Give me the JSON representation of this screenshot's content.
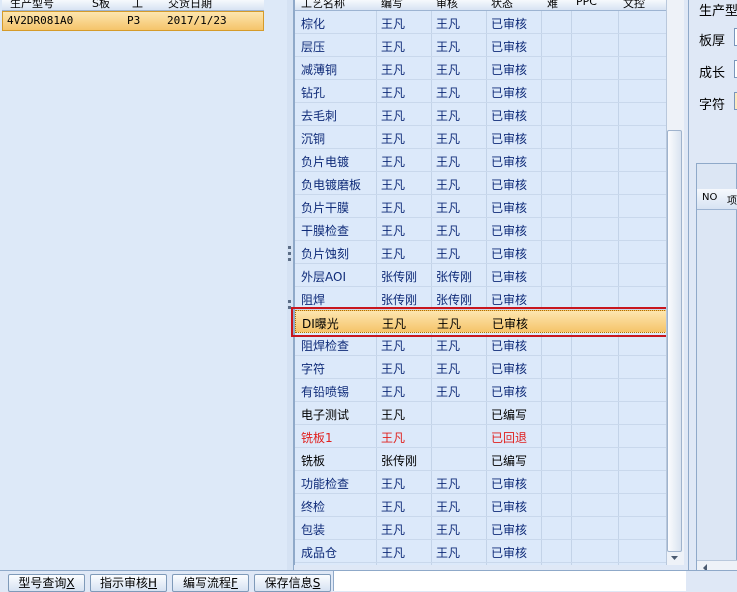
{
  "left_table": {
    "columns": [
      "生产型号",
      "S板",
      "工",
      "交货日期"
    ],
    "rows": [
      {
        "model": "4V2DR081A0",
        "board": "",
        "process": "P3",
        "date": "2017/1/23"
      }
    ]
  },
  "grid": {
    "columns": [
      "工艺名称",
      "编写",
      "审核",
      "状态",
      "难",
      "PPC",
      "文控"
    ],
    "rows": [
      {
        "process": "棕化",
        "writer": "王凡",
        "reviewer": "王凡",
        "status": "已审核",
        "kind": "normal"
      },
      {
        "process": "层压",
        "writer": "王凡",
        "reviewer": "王凡",
        "status": "已审核",
        "kind": "normal"
      },
      {
        "process": "减薄铜",
        "writer": "王凡",
        "reviewer": "王凡",
        "status": "已审核",
        "kind": "normal"
      },
      {
        "process": "钻孔",
        "writer": "王凡",
        "reviewer": "王凡",
        "status": "已审核",
        "kind": "normal"
      },
      {
        "process": "去毛刺",
        "writer": "王凡",
        "reviewer": "王凡",
        "status": "已审核",
        "kind": "normal"
      },
      {
        "process": "沉铜",
        "writer": "王凡",
        "reviewer": "王凡",
        "status": "已审核",
        "kind": "normal"
      },
      {
        "process": "负片电镀",
        "writer": "王凡",
        "reviewer": "王凡",
        "status": "已审核",
        "kind": "normal"
      },
      {
        "process": "负电镀磨板",
        "writer": "王凡",
        "reviewer": "王凡",
        "status": "已审核",
        "kind": "normal"
      },
      {
        "process": "负片干膜",
        "writer": "王凡",
        "reviewer": "王凡",
        "status": "已审核",
        "kind": "normal"
      },
      {
        "process": "干膜检查",
        "writer": "王凡",
        "reviewer": "王凡",
        "status": "已审核",
        "kind": "normal"
      },
      {
        "process": "负片蚀刻",
        "writer": "王凡",
        "reviewer": "王凡",
        "status": "已审核",
        "kind": "normal"
      },
      {
        "process": "外层AOI",
        "writer": "张传刚",
        "reviewer": "张传刚",
        "status": "已审核",
        "kind": "normal"
      },
      {
        "process": "阻焊",
        "writer": "张传刚",
        "reviewer": "张传刚",
        "status": "已审核",
        "kind": "normal"
      },
      {
        "process": "DI曝光",
        "writer": "王凡",
        "reviewer": "王凡",
        "status": "已审核",
        "kind": "selected"
      },
      {
        "process": "阻焊检查",
        "writer": "王凡",
        "reviewer": "王凡",
        "status": "已审核",
        "kind": "normal"
      },
      {
        "process": "字符",
        "writer": "王凡",
        "reviewer": "王凡",
        "status": "已审核",
        "kind": "normal"
      },
      {
        "process": "有铅喷锡",
        "writer": "王凡",
        "reviewer": "王凡",
        "status": "已审核",
        "kind": "normal"
      },
      {
        "process": "电子测试",
        "writer": "王凡",
        "reviewer": "",
        "status": "已编写",
        "kind": "plain"
      },
      {
        "process": "铣板1",
        "writer": "王凡",
        "reviewer": "",
        "status": "已回退",
        "kind": "returned"
      },
      {
        "process": "铣板",
        "writer": "张传刚",
        "reviewer": "",
        "status": "已编写",
        "kind": "plain"
      },
      {
        "process": "功能检查",
        "writer": "王凡",
        "reviewer": "王凡",
        "status": "已审核",
        "kind": "normal"
      },
      {
        "process": "终检",
        "writer": "王凡",
        "reviewer": "王凡",
        "status": "已审核",
        "kind": "normal"
      },
      {
        "process": "包装",
        "writer": "王凡",
        "reviewer": "王凡",
        "status": "已审核",
        "kind": "normal"
      },
      {
        "process": "成品仓",
        "writer": "王凡",
        "reviewer": "王凡",
        "status": "已审核",
        "kind": "normal"
      }
    ]
  },
  "right_panel": {
    "title": "生产型",
    "labels": [
      "板厚",
      "成长",
      "字符"
    ],
    "sub_headers": [
      "NO",
      "项"
    ]
  },
  "toolbar": {
    "buttons": [
      {
        "label": "型号查询",
        "key": "X"
      },
      {
        "label": "指示审核",
        "key": "H"
      },
      {
        "label": "编写流程",
        "key": "F"
      },
      {
        "label": "保存信息",
        "key": "S"
      }
    ]
  },
  "colors": {
    "selected_row": "#f5c46a",
    "normal_text": "#0e2a78",
    "returned_text": "#e0201e",
    "highlight_box": "#c8161e"
  }
}
